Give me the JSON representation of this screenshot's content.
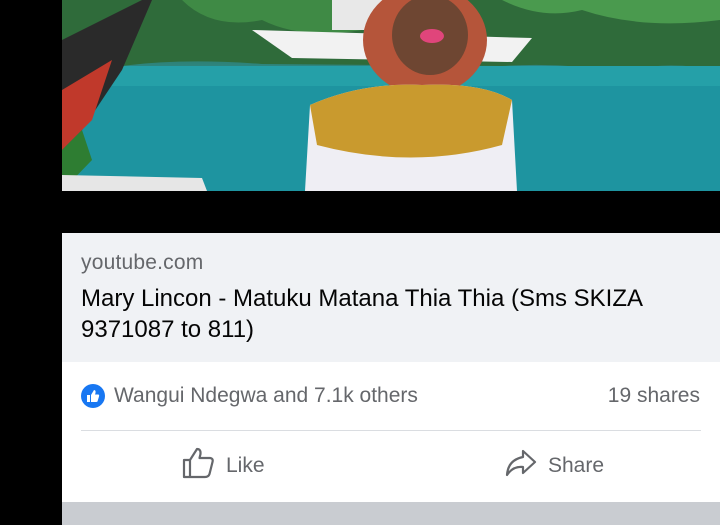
{
  "link_preview": {
    "domain": "youtube.com",
    "title": "Mary Lincon - Matuku Matana Thia Thia (Sms SKIZA 9371087 to 811)"
  },
  "post_stats": {
    "reactors": "Wangui Ndegwa and 7.1k others",
    "shares": "19 shares"
  },
  "actions": {
    "like_label": "Like",
    "share_label": "Share"
  },
  "colors": {
    "like_blue": "#1877f2",
    "secondary_text": "#65676b",
    "card_background": "#f0f2f5"
  },
  "icons": {
    "reaction": "thumbs-up-icon",
    "like": "thumbs-up-outline-icon",
    "share": "share-arrow-icon"
  }
}
